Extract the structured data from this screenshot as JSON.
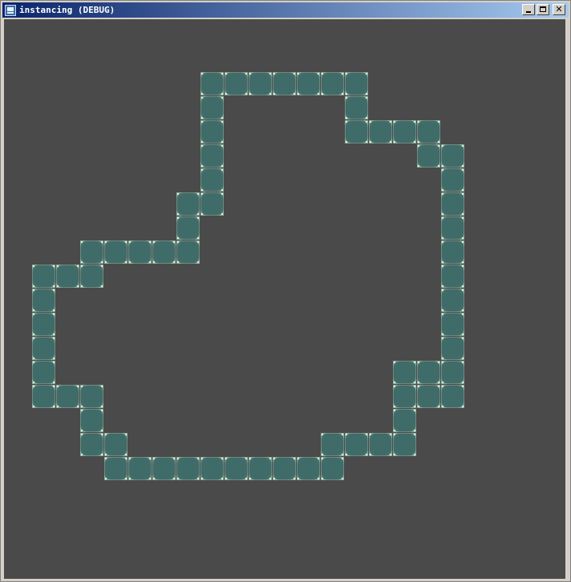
{
  "window": {
    "title": "instancing (DEBUG)",
    "icon": "app-icon",
    "controls": [
      "minimize-icon",
      "maximize-icon",
      "close-icon"
    ]
  },
  "viewport": {
    "background_color": "#4a4a4a",
    "tile_color": "#3f6b69",
    "tile_edge_color": "#d8f5dc"
  }
}
